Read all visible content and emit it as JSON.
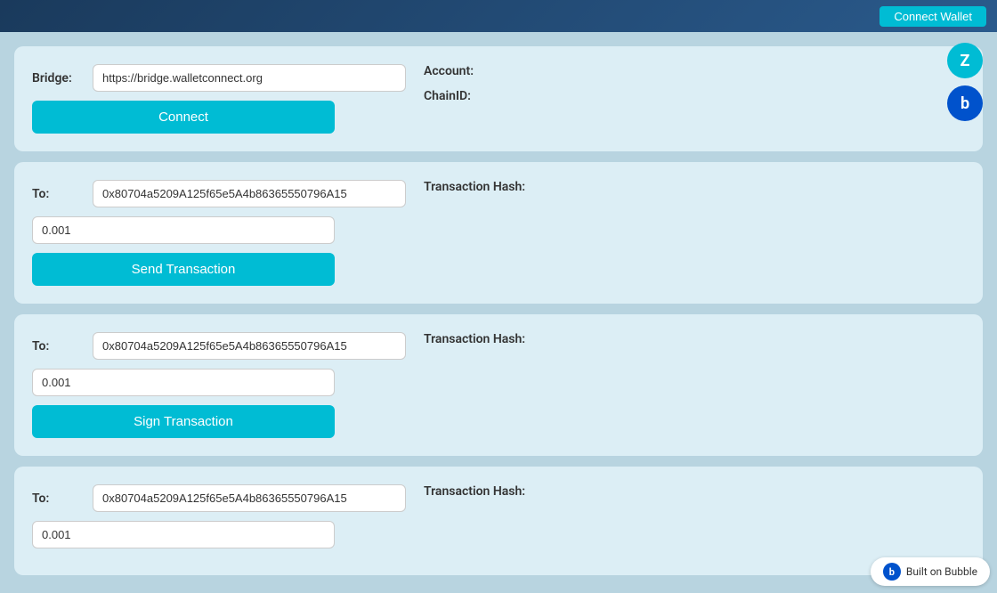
{
  "header": {
    "connect_wallet_label": "Connect Wallet"
  },
  "bridge_card": {
    "bridge_label": "Bridge:",
    "bridge_placeholder": "https://bridge.walletconnect.org",
    "bridge_value": "https://bridge.walletconnect.org",
    "connect_button": "Connect",
    "account_label": "Account:",
    "account_value": "",
    "chainid_label": "ChainID:",
    "chainid_value": ""
  },
  "send_transaction_card": {
    "to_label": "To:",
    "to_value": "0x80704a5209A125f65e5A4b86365550796A15",
    "amount_value": "0.001",
    "send_button": "Send Transaction",
    "transaction_hash_label": "Transaction Hash:",
    "transaction_hash_value": ""
  },
  "sign_transaction_card": {
    "to_label": "To:",
    "to_value": "0x80704a5209A125f65e5A4b86365550796A15",
    "amount_value": "0.001",
    "sign_button": "Sign Transaction",
    "transaction_hash_label": "Transaction Hash:",
    "transaction_hash_value": ""
  },
  "third_card": {
    "to_label": "To:",
    "to_value": "0x80704a5209A125f65e5A4b86365550796A15",
    "amount_value": "0.001",
    "transaction_hash_label": "Transaction Hash:",
    "transaction_hash_value": ""
  },
  "floating_icons": {
    "z_icon": "Z",
    "b_icon": "b"
  },
  "built_on_bubble": {
    "text": "Built on Bubble"
  }
}
